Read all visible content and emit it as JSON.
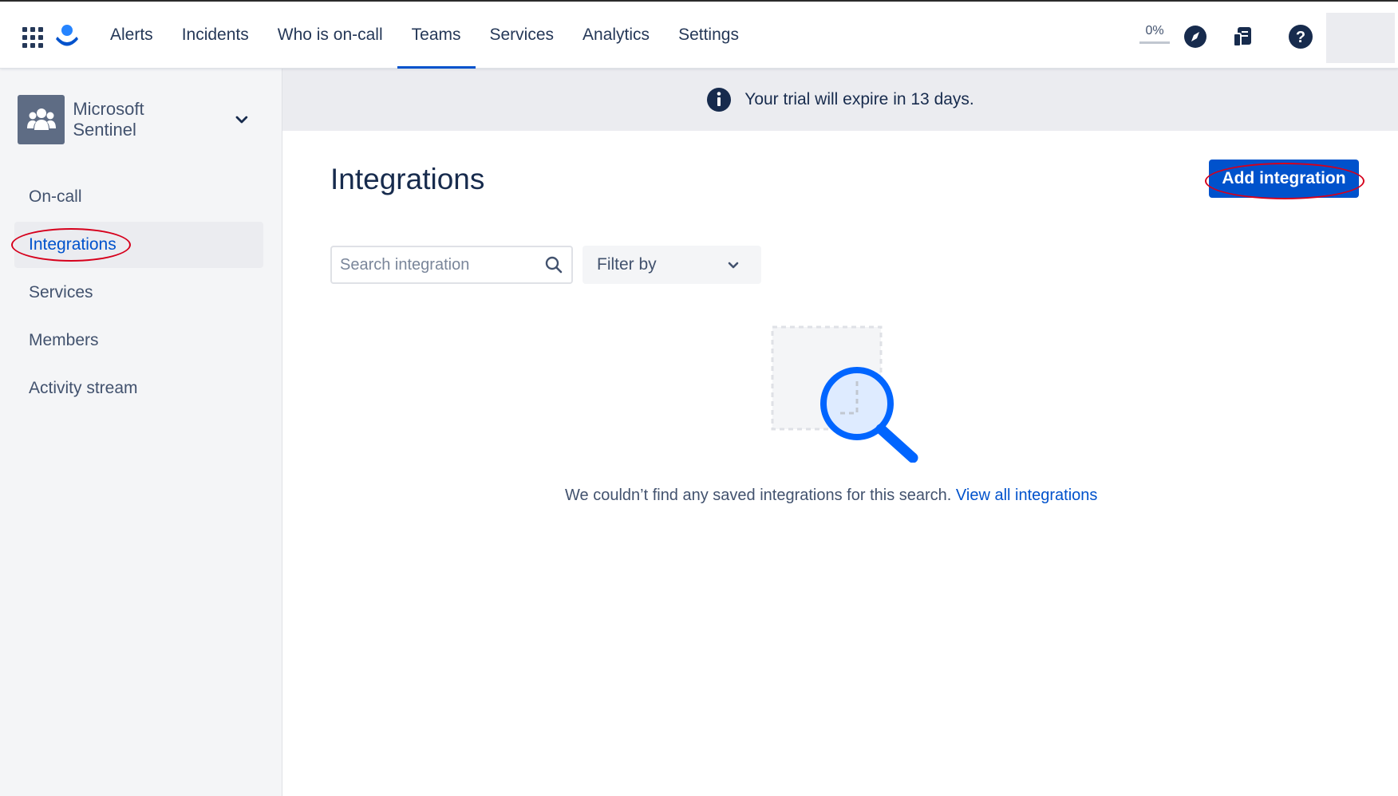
{
  "nav": {
    "items": [
      {
        "label": "Alerts"
      },
      {
        "label": "Incidents"
      },
      {
        "label": "Who is on-call"
      },
      {
        "label": "Teams",
        "active": true
      },
      {
        "label": "Services"
      },
      {
        "label": "Analytics"
      },
      {
        "label": "Settings"
      }
    ],
    "progress_text": "0%",
    "progress_value": 0,
    "icons": [
      "app-switcher-icon",
      "opsgenie-logo",
      "compass-icon",
      "notes-icon",
      "help-icon"
    ]
  },
  "sidebar": {
    "team_name": "Microsoft Sentinel",
    "items": [
      {
        "label": "On-call"
      },
      {
        "label": "Integrations",
        "active": true
      },
      {
        "label": "Services"
      },
      {
        "label": "Members"
      },
      {
        "label": "Activity stream"
      }
    ]
  },
  "banner": {
    "text": "Your trial will expire in 13 days."
  },
  "main": {
    "title": "Integrations",
    "add_button": "Add integration",
    "search_placeholder": "Search integration",
    "filter_label": "Filter by",
    "empty_text": "We couldn’t find any saved integrations for this search.",
    "empty_link": "View all integrations"
  },
  "colors": {
    "accent": "#0052cc",
    "highlight_ring": "#d6001c",
    "sidebar_bg": "#f4f5f7",
    "banner_bg": "#ebecf0"
  }
}
